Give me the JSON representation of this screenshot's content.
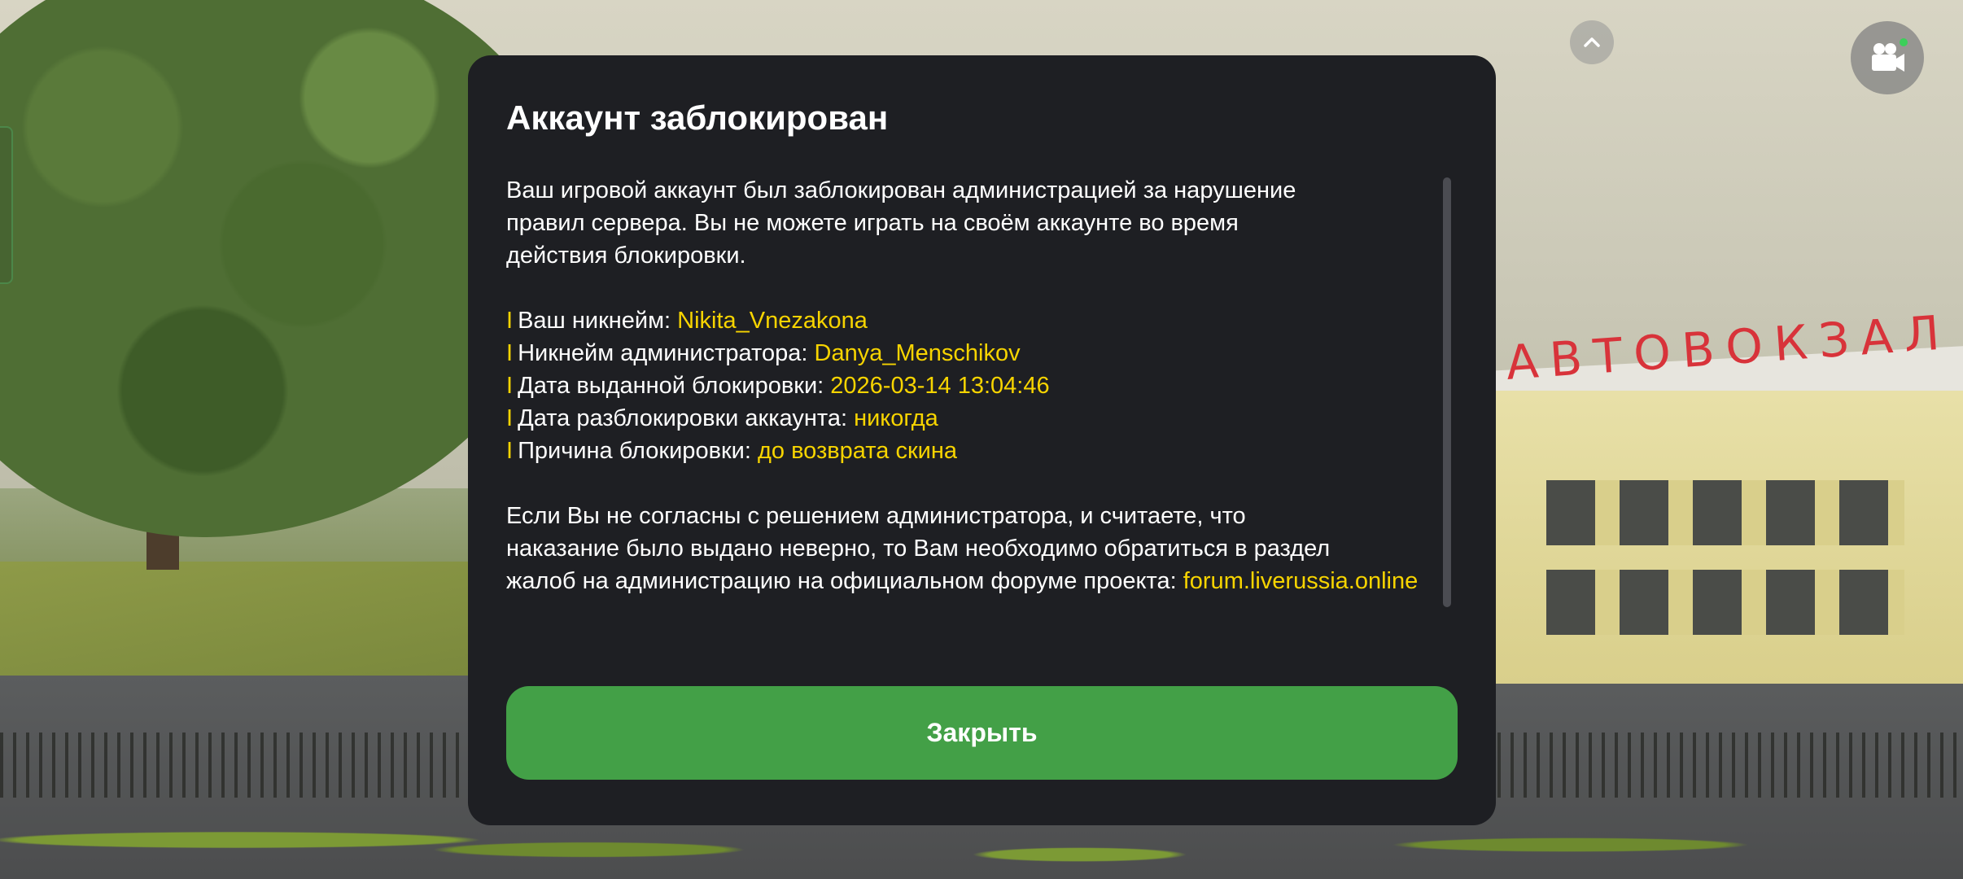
{
  "scene": {
    "sign_text": "АВТОВОКЗАЛ"
  },
  "hud": {
    "chevron_icon": "chevron-up-icon",
    "camera_icon": "video-camera-icon",
    "camera_status_color": "#3ccf5a"
  },
  "modal": {
    "title": "Аккаунт заблокирован",
    "intro_lines": [
      "Ваш игровой аккаунт был заблокирован администрацией за нарушение",
      "правил сервера. Вы не можете играть на своём аккаунте во время",
      "действия блокировки."
    ],
    "details": [
      {
        "marker": "I",
        "label": "Ваш никнейм: ",
        "value": "Nikita_Vnezakona"
      },
      {
        "marker": "I",
        "label": "Никнейм администратора: ",
        "value": "Danya_Menschikov"
      },
      {
        "marker": "I",
        "label": "Дата выданной блокировки: ",
        "value": "2026-03-14 13:04:46"
      },
      {
        "marker": "I",
        "label": "Дата разблокировки аккаунта: ",
        "value": "никогда"
      },
      {
        "marker": "I",
        "label": "Причина блокировки: ",
        "value": "до возврата скина"
      }
    ],
    "appeal_lines": [
      "Если Вы не согласны с решением администратора, и считаете, что",
      "наказание было выдано неверно, то Вам необходимо обратиться в раздел",
      "жалоб на администрацию на официальном форуме проекта: "
    ],
    "forum_link": "forum.liverussia.online",
    "close_label": "Закрыть",
    "accent_color": "#f7d400",
    "button_color": "#43a047"
  }
}
